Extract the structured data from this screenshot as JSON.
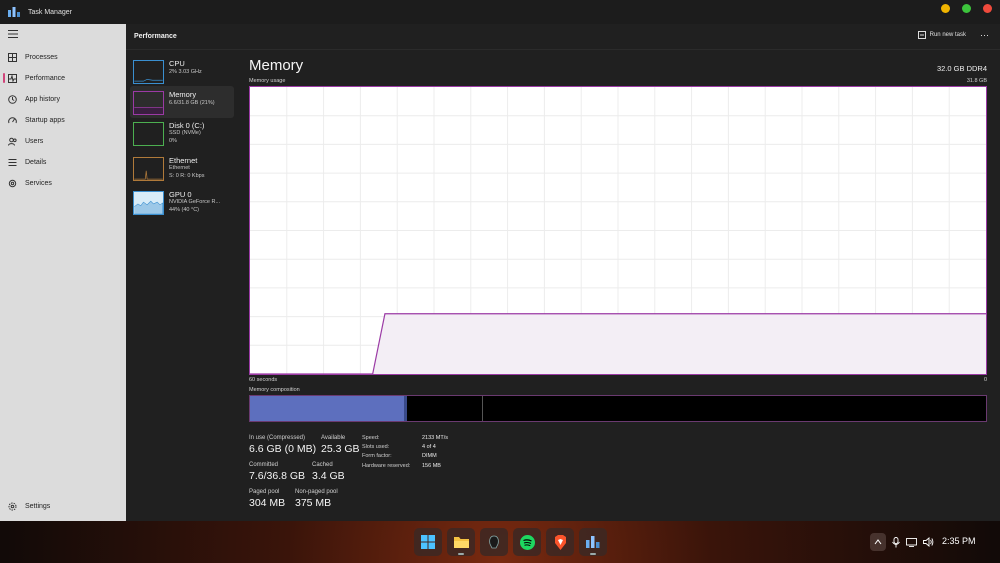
{
  "window": {
    "title": "Task Manager"
  },
  "nav": {
    "items": [
      {
        "label": "Processes",
        "icon": "grid-icon"
      },
      {
        "label": "Performance",
        "icon": "pulse-icon",
        "active": true
      },
      {
        "label": "App history",
        "icon": "history-icon"
      },
      {
        "label": "Startup apps",
        "icon": "speedometer-icon"
      },
      {
        "label": "Users",
        "icon": "users-icon"
      },
      {
        "label": "Details",
        "icon": "list-icon"
      },
      {
        "label": "Services",
        "icon": "puzzle-icon"
      }
    ],
    "settings": "Settings"
  },
  "header": {
    "title": "Performance",
    "run_task": "Run new task"
  },
  "devices": [
    {
      "name": "CPU",
      "sub1": "2% 3.03 GHz",
      "sub2": "",
      "color": "#3a8fd0"
    },
    {
      "name": "Memory",
      "sub1": "6.6/31.8 GB (21%)",
      "sub2": "",
      "color": "#9b3aa5",
      "selected": true
    },
    {
      "name": "Disk 0 (C:)",
      "sub1": "SSD (NVMe)",
      "sub2": "0%",
      "color": "#4caf50"
    },
    {
      "name": "Ethernet",
      "sub1": "Ethernet",
      "sub2": "S: 0 R: 0 Kbps",
      "color": "#b07a3a"
    },
    {
      "name": "GPU 0",
      "sub1": "NVIDIA GeForce R...",
      "sub2": "44% (40 °C)",
      "color": "#3a8fd0"
    }
  ],
  "main": {
    "title": "Memory",
    "total": "32.0 GB DDR4",
    "usage_label": "Memory usage",
    "usage_max": "31.8 GB",
    "time_left": "60 seconds",
    "time_right": "0",
    "composition_label": "Memory composition",
    "stats": {
      "in_use_label": "In use (Compressed)",
      "in_use": "6.6 GB (0 MB)",
      "available_label": "Available",
      "available": "25.3 GB",
      "committed_label": "Committed",
      "committed": "7.6/36.8 GB",
      "cached_label": "Cached",
      "cached": "3.4 GB",
      "paged_label": "Paged pool",
      "paged": "304 MB",
      "nonpaged_label": "Non-paged pool",
      "nonpaged": "375 MB"
    },
    "props": [
      {
        "k": "Speed:",
        "v": "2133 MT/s"
      },
      {
        "k": "Slots used:",
        "v": "4 of 4"
      },
      {
        "k": "Form factor:",
        "v": "DIMM"
      },
      {
        "k": "Hardware reserved:",
        "v": "156 MB"
      }
    ],
    "usage_series": [
      0,
      0,
      0,
      0,
      0,
      0,
      0,
      0,
      0,
      0,
      0,
      21,
      21,
      21,
      21,
      21,
      21,
      21,
      21,
      21,
      21,
      21,
      21,
      21,
      21,
      21,
      21,
      21,
      21,
      21,
      21,
      21,
      21,
      21,
      21,
      21,
      21,
      21,
      21,
      21,
      21,
      21,
      21,
      21,
      21,
      21,
      21,
      21,
      21,
      21,
      21,
      21,
      21,
      21,
      21,
      21,
      21,
      21,
      21,
      21,
      21
    ],
    "composition": {
      "in_use_gb": 6.6,
      "standby_gb": 3.4,
      "total_gb": 31.8
    }
  },
  "taskbar": {
    "apps": [
      "windows-start-icon",
      "file-explorer-icon",
      "alienware-icon",
      "spotify-icon",
      "brave-icon",
      "task-manager-icon"
    ],
    "time": "2:35 PM"
  }
}
